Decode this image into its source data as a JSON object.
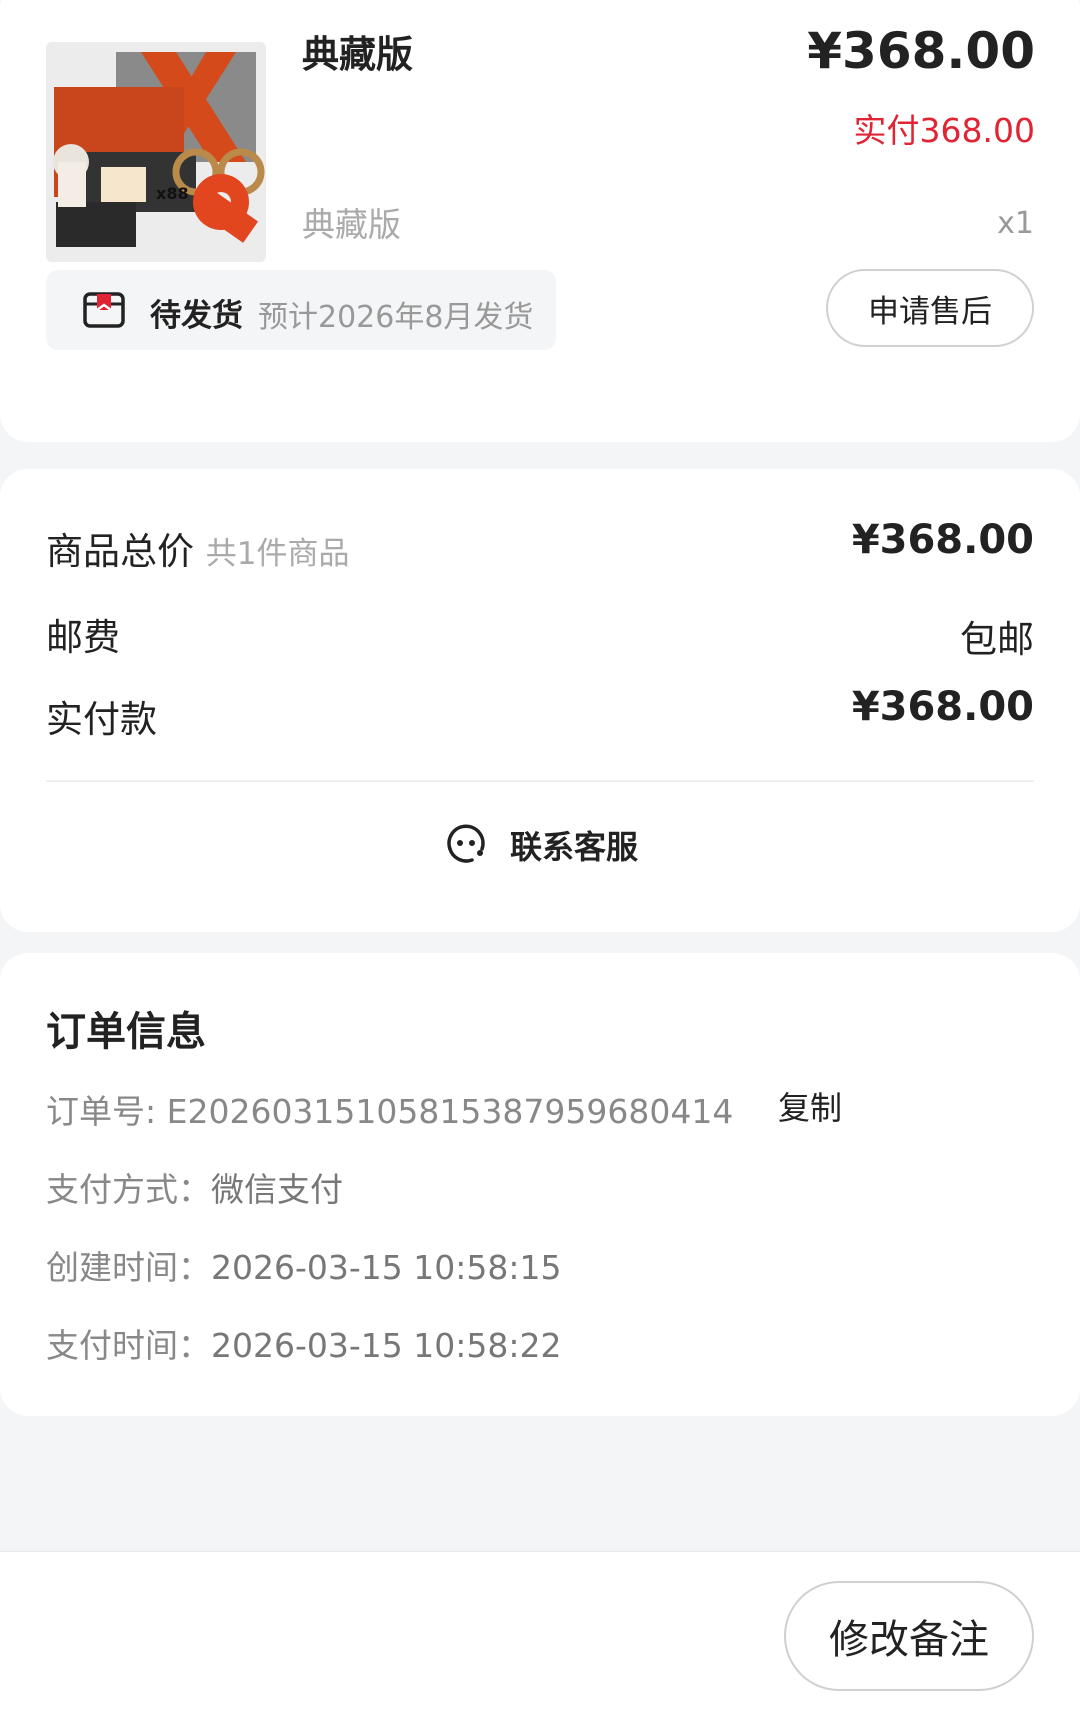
{
  "product": {
    "title": "典藏版",
    "price": "¥368.00",
    "paid": "实付368.00",
    "spec": "典藏版",
    "quantity": "x1",
    "thumb_caption": "x88",
    "status": "待发货",
    "status_note": "预计2026年8月发货",
    "after_sales_label": "申请售后"
  },
  "summary": {
    "total_label": "商品总价",
    "total_count": "共1件商品",
    "total_value": "¥368.00",
    "shipping_label": "邮费",
    "shipping_value": "包邮",
    "paid_label": "实付款",
    "paid_value": "¥368.00",
    "service_label": "联系客服"
  },
  "order": {
    "title": "订单信息",
    "number_label": "订单号: E20260315105815387959680414",
    "copy_label": "复制",
    "pay_method_label": "支付方式：",
    "pay_method_value": "微信支付",
    "created_label": "创建时间：",
    "created_value": "2026-03-15 10:58:15",
    "paid_time_label": "支付时间：",
    "paid_time_value": "2026-03-15 10:58:22"
  },
  "bottom": {
    "remark_label": "修改备注"
  },
  "colors": {
    "accent_red": "#e02433",
    "background": "#f4f5f7"
  }
}
